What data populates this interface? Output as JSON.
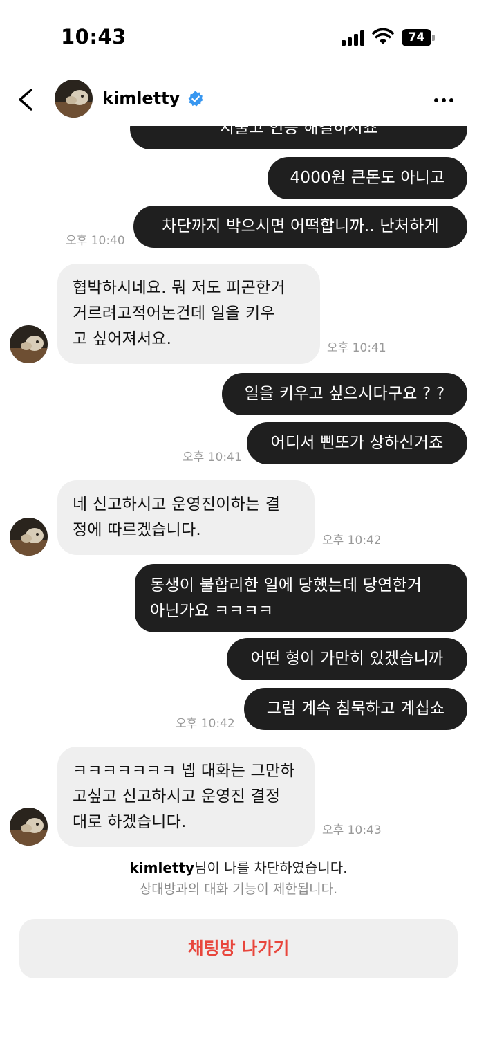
{
  "status": {
    "time": "10:43",
    "battery": "74"
  },
  "header": {
    "name": "kimletty"
  },
  "messages": [
    {
      "from": "me",
      "text": "지불고 인증 해결하시죠"
    },
    {
      "from": "me",
      "text": "4000원 큰돈도 아니고"
    },
    {
      "from": "me",
      "text": "차단까지 박으시면 어떡합니까.. 난처하게",
      "time": "오후 10:40"
    },
    {
      "from": "them",
      "lines": [
        "협박하시네요. 뭐 저도 피곤한거",
        "거르려고적어논건데 일을 키우",
        "고 싶어져서요."
      ],
      "time": "오후 10:41"
    },
    {
      "from": "me",
      "text": "일을 키우고 싶으시다구요 ? ?"
    },
    {
      "from": "me",
      "text": "어디서 삔또가 상하신거죠",
      "time": "오후 10:41"
    },
    {
      "from": "them",
      "lines": [
        "네 신고하시고 운영진이하는 결",
        "정에 따르겠습니다."
      ],
      "time": "오후 10:42"
    },
    {
      "from": "me",
      "lines": [
        "동생이 불합리한 일에 당했는데 당연한거",
        "아닌가요 ㅋㅋㅋㅋ"
      ]
    },
    {
      "from": "me",
      "text": "어떤 형이 가만히 있겠습니까"
    },
    {
      "from": "me",
      "text": "그럼 계속 침묵하고 계십쇼",
      "time": "오후 10:42"
    },
    {
      "from": "them",
      "lines": [
        "ㅋㅋㅋㅋㅋㅋㅋ 넵 대화는 그만하",
        "고싶고 신고하시고 운영진 결정",
        "대로 하겠습니다."
      ],
      "time": "오후 10:43"
    }
  ],
  "block_notice": {
    "name": "kimletty",
    "line1_suffix": "님이 나를 차단하였습니다.",
    "line2": "상대방과의 대화 기능이 제한됩니다."
  },
  "leave_button": {
    "label": "채팅방 나가기",
    "color": "#e8463c"
  },
  "colors": {
    "my_bubble": "#1f1f1f",
    "their_bubble": "#efefef",
    "verified": "#3897f0"
  }
}
